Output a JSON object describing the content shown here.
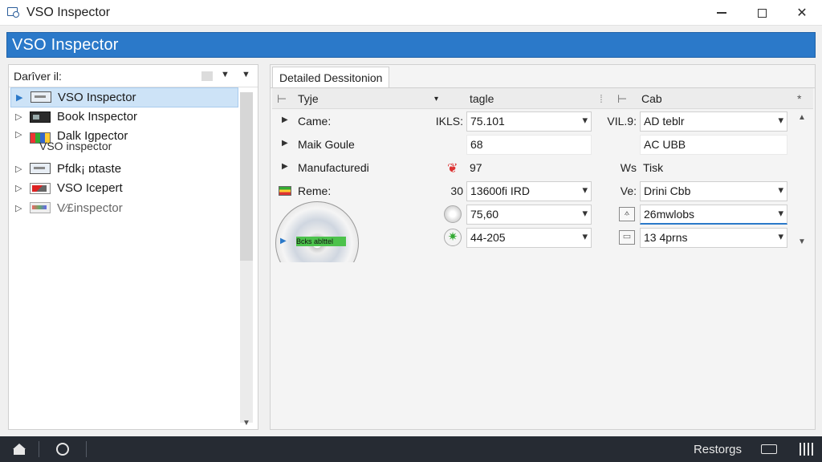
{
  "window": {
    "title": "VSO Inspector"
  },
  "header": {
    "title": "VSO Inspector"
  },
  "left_panel": {
    "header_label": "Darîver il:",
    "items": [
      {
        "label": "VSO Inspector",
        "icon": "monitor-icon",
        "arrow": "▶",
        "selected": true
      },
      {
        "label": "Book Inspector",
        "icon": "drive-icon",
        "arrow": "▷"
      },
      {
        "label": "Dalk Igpector",
        "sub": "VSO inspector",
        "icon": "multi-drive-icon",
        "arrow": "▷"
      },
      {
        "label": "Pfdk¡ ɒtaste",
        "icon": "monitor-icon",
        "arrow": "▷"
      },
      {
        "label": "VSO Icepert",
        "icon": "red-drive-icon",
        "arrow": "▷"
      },
      {
        "label": "V⁄£inspector",
        "icon": "disc-drive-icon",
        "arrow": "▷",
        "dim": true
      }
    ]
  },
  "right_panel": {
    "tab_label": "Detailed Dessitonion",
    "columns": {
      "type": "Tyje",
      "mid": "tagle",
      "right": "Cab"
    },
    "rows": [
      {
        "label": "Came:",
        "mid_label": "IKLS:",
        "field1": "75.101",
        "right_label": "VIL.9:",
        "field2": "AD teblr"
      },
      {
        "label": "Maik Goule",
        "field1": "68",
        "field2": "AC UBB"
      },
      {
        "label": "Manufacturedi",
        "field1": "97",
        "right_label": "Ws",
        "field2": "Tisk"
      },
      {
        "label": "Reme:",
        "mid_label": "30",
        "field1": "13600fi IRD",
        "right_label": "Ve:",
        "field2": "Drini Cbb"
      },
      {
        "field1": "75,60",
        "field2": "26mwlobs"
      },
      {
        "field1": "44-205",
        "field2": "13 4prns"
      }
    ],
    "disc_badge": "Bcks ablttel"
  },
  "statusbar": {
    "text": "Restorgs"
  }
}
